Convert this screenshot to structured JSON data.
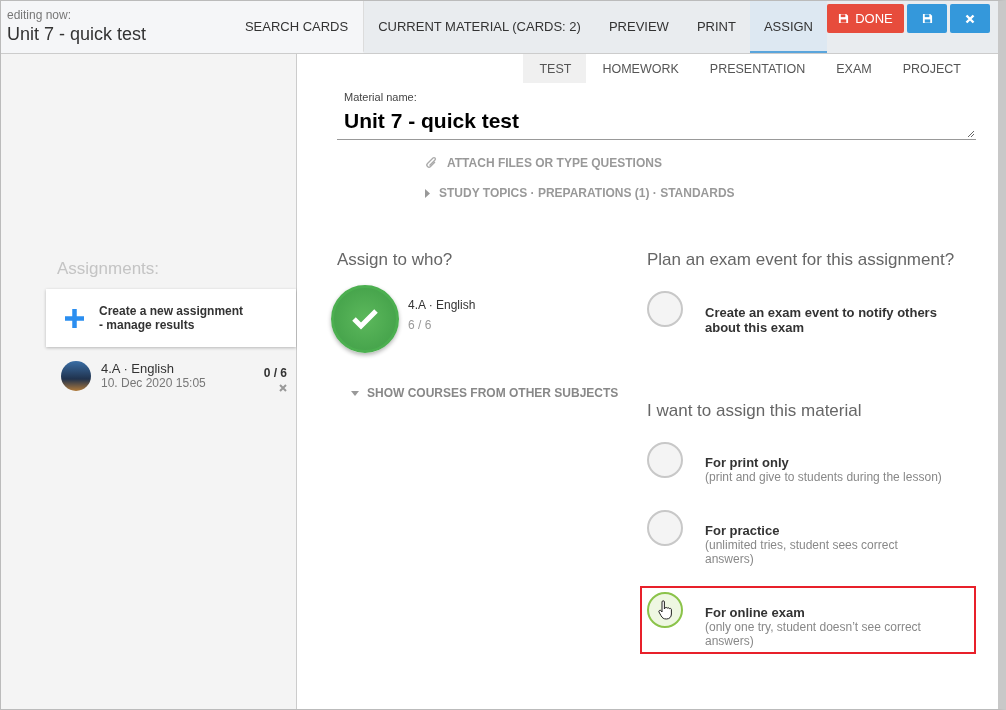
{
  "header": {
    "caption": "editing now:",
    "title": "Unit 7 - quick test",
    "tabs": [
      {
        "label": "SEARCH CARDS",
        "selected": false
      },
      {
        "label": "CURRENT MATERIAL (CARDS: 2)",
        "selected": false
      },
      {
        "label": "PREVIEW",
        "selected": false
      },
      {
        "label": "PRINT",
        "selected": false
      },
      {
        "label": "ASSIGN",
        "selected": true
      }
    ],
    "buttons": [
      {
        "kind": "done",
        "label": "DONE"
      },
      {
        "kind": "save"
      },
      {
        "kind": "close"
      }
    ]
  },
  "sidebar": {
    "heading": "Assignments:",
    "create": {
      "line1": "Create a new assignment",
      "line2": "- manage results"
    },
    "items": [
      {
        "title": "4.A · English",
        "date": "10. Dec 2020 15:05",
        "count": "0 / 6"
      }
    ]
  },
  "material_types": [
    {
      "label": "TEST",
      "selected": true
    },
    {
      "label": "HOMEWORK",
      "selected": false
    },
    {
      "label": "PRESENTATION",
      "selected": false
    },
    {
      "label": "EXAM",
      "selected": false
    },
    {
      "label": "PROJECT",
      "selected": false
    }
  ],
  "material_name": {
    "label": "Material name:",
    "value": "Unit 7 - quick test"
  },
  "attach_link": "ATTACH FILES OR TYPE QUESTIONS",
  "topics_link": "STUDY TOPICS · PREPARATIONS (1) · STANDARDS",
  "assign_to": {
    "heading": "Assign to who?",
    "courses": [
      {
        "name": "4.A · English",
        "count": "6 / 6",
        "selected": true
      }
    ],
    "more_link": "SHOW COURSES FROM OTHER SUBJECTS"
  },
  "exam_event": {
    "heading": "Plan an exam event for this assignment?",
    "options": [
      {
        "title": "Create an exam event to notify others about this exam",
        "selected": false,
        "highlighted": false
      }
    ]
  },
  "assign_mode": {
    "heading": "I want to assign this material",
    "options": [
      {
        "title": "For print only",
        "description": "(print and give to students during the lesson)",
        "selected": false,
        "highlighted": false
      },
      {
        "title": "For practice",
        "description": "(unlimited tries, student sees correct answers)",
        "selected": false,
        "highlighted": false
      },
      {
        "title": "For online exam",
        "description": "(only one try, student doesn’t see correct answers)",
        "selected": true,
        "highlighted": true
      }
    ]
  }
}
